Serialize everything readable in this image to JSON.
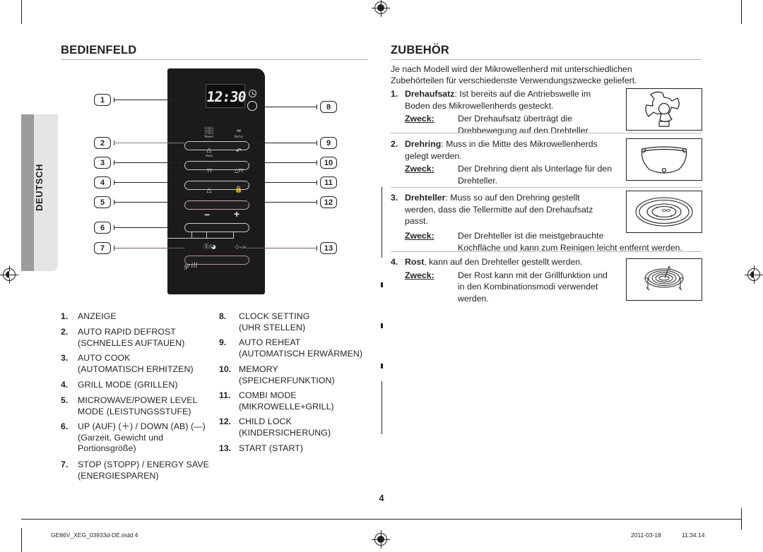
{
  "sidebar": {
    "tab_label": "DEUTSCH"
  },
  "left": {
    "heading": "BEDIENFELD",
    "panel": {
      "display_value": "12:30",
      "grill_label": "grill",
      "button_icons": [
        {
          "glyph": "☷",
          "sub": "Power"
        },
        {
          "glyph": "♒",
          "sub": "Defro"
        },
        {
          "glyph": "△",
          "sub": "Auto"
        },
        {
          "glyph": "↶",
          "sub": ""
        },
        {
          "glyph": "ᴛᴛ",
          "sub": ""
        },
        {
          "glyph": "△ᴛᴛ",
          "sub": ""
        },
        {
          "glyph": "△",
          "sub": ""
        },
        {
          "glyph": "ὑ2",
          "sub": ""
        },
        {
          "glyph": "−",
          "sub": ""
        },
        {
          "glyph": "+",
          "sub": ""
        },
        {
          "glyph": "ⓧ/◑",
          "sub": ""
        },
        {
          "glyph": "▷ +30s",
          "sub": ""
        }
      ]
    },
    "callouts_left": [
      "1",
      "2",
      "3",
      "4",
      "5",
      "6",
      "7"
    ],
    "callouts_right": [
      "8",
      "9",
      "10",
      "11",
      "12",
      "13"
    ],
    "legend_col1": [
      {
        "num": "1.",
        "text": "ANZEIGE"
      },
      {
        "num": "2.",
        "text": "AUTO RAPID DEFROST\n(SCHNELLES AUFTAUEN)"
      },
      {
        "num": "3.",
        "text": "AUTO COOK\n(AUTOMATISCH ERHITZEN)"
      },
      {
        "num": "4.",
        "text": "GRILL MODE (GRILLEN)"
      },
      {
        "num": "5.",
        "text": "MICROWAVE/POWER LEVEL\nMODE (LEISTUNGSSTUFE)"
      },
      {
        "num": "6.",
        "text": "UP (AUF) (＋) / DOWN (AB) (—)\n(Garzeit, Gewicht und\nPortionsgröße)"
      },
      {
        "num": "7.",
        "text": "STOP (STOPP) / ENERGY SAVE\n(ENERGIESPAREN)"
      }
    ],
    "legend_col2": [
      {
        "num": "8.",
        "text": "CLOCK SETTING\n(UHR STELLEN)"
      },
      {
        "num": "9.",
        "text": "AUTO REHEAT\n(AUTOMATISCH ERWÄRMEN)"
      },
      {
        "num": "10.",
        "text": "MEMORY\n(SPEICHERFUNKTION)"
      },
      {
        "num": "11.",
        "text": "COMBI MODE\n(MIKROWELLE+GRILL)"
      },
      {
        "num": "12.",
        "text": "CHILD LOCK\n(KINDERSICHERUNG)"
      },
      {
        "num": "13.",
        "text": "START (START)"
      }
    ]
  },
  "right": {
    "heading": "ZUBEHÖR",
    "intro_line1": "Je nach Modell wird der Mikrowellenherd mit unterschiedlichen",
    "intro_line2": "Zubehörteilen für verschiedenste Verwendungszwecke geliefert.",
    "zweck_label": "Zweck:",
    "items": [
      {
        "num": "1.",
        "title": "Drehaufsatz",
        "desc": ": Ist bereits auf die Antriebswelle im",
        "desc2": "Boden des Mikrowellenherds gesteckt.",
        "purpose_line1": "Der Drehaufsatz überträgt die",
        "purpose_line2": "Drehbewegung auf den Drehteller.",
        "icon": "coupler-icon"
      },
      {
        "num": "2.",
        "title": "Drehring",
        "desc": ": Muss in die Mitte des Mikrowellenherds",
        "desc2": "gelegt werden.",
        "purpose_line1": "Der Drehring dient als Unterlage für den",
        "purpose_line2": "Drehteller.",
        "icon": "roller-ring-icon"
      },
      {
        "num": "3.",
        "title": "Drehteller",
        "desc": ": Muss so auf den Drehring gestellt",
        "desc2": "werden, dass die Tellermitte auf den Drehaufsatz",
        "desc3": "passt.",
        "purpose_line1": "Der Drehteller ist die meistgebrauchte",
        "purpose_line2": "Kochüäche und kann zum Reinigen leicht entfernt werden.",
        "purpose_line2_fixed": "Kochfläche und kann zum Reinigen leicht entfernt werden.",
        "icon": "turntable-icon"
      },
      {
        "num": "4.",
        "title": "Rost",
        "desc": ", kann auf den Drehteller gestellt werden.",
        "purpose_line1": "Der Rost kann mit der Grillfunktion und",
        "purpose_line2": "in den Kombinationsmodi verwendet",
        "purpose_line3": "werden.",
        "icon": "grill-rack-icon"
      }
    ]
  },
  "page_number": "4",
  "footer": {
    "file": "GE86V_XEG_03933d-DE.indd   4",
    "date": "2011-03-18",
    "time": "11:34:14"
  }
}
